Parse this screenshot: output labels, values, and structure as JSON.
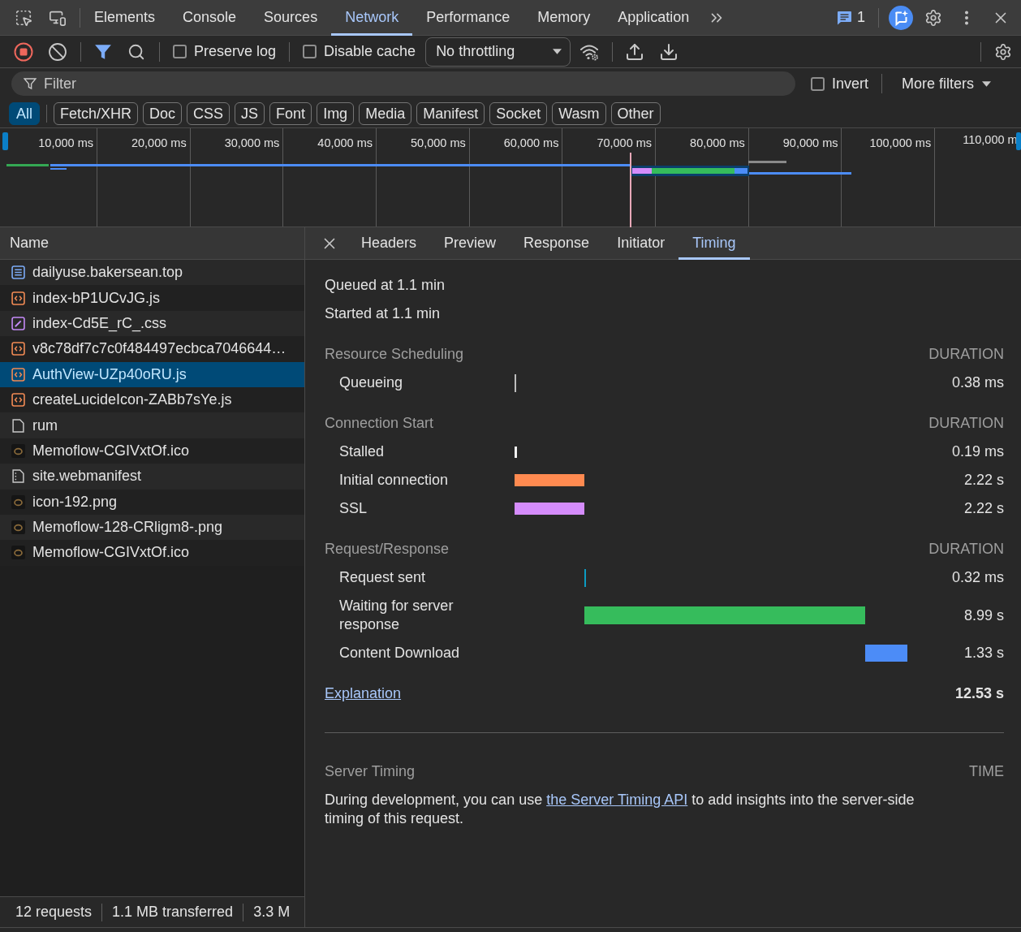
{
  "main_tabs": {
    "tabs": [
      {
        "label": "Elements",
        "selected": false
      },
      {
        "label": "Console",
        "selected": false
      },
      {
        "label": "Sources",
        "selected": false
      },
      {
        "label": "Network",
        "selected": true
      },
      {
        "label": "Performance",
        "selected": false
      },
      {
        "label": "Memory",
        "selected": false
      },
      {
        "label": "Application",
        "selected": false
      }
    ],
    "issues_count": "1"
  },
  "toolbar": {
    "recording": true,
    "filter_toggled": true,
    "preserve_log": {
      "label": "Preserve log",
      "checked": false
    },
    "disable_cache": {
      "label": "Disable cache",
      "checked": false
    },
    "throttling": "No throttling"
  },
  "filter_bar": {
    "placeholder": "Filter",
    "invert": {
      "label": "Invert",
      "checked": false
    },
    "more_filters": "More filters"
  },
  "type_filters": [
    {
      "label": "All",
      "selected": true
    },
    {
      "label": "Fetch/XHR",
      "selected": false
    },
    {
      "label": "Doc",
      "selected": false
    },
    {
      "label": "CSS",
      "selected": false
    },
    {
      "label": "JS",
      "selected": false
    },
    {
      "label": "Font",
      "selected": false
    },
    {
      "label": "Img",
      "selected": false
    },
    {
      "label": "Media",
      "selected": false
    },
    {
      "label": "Manifest",
      "selected": false
    },
    {
      "label": "Socket",
      "selected": false
    },
    {
      "label": "Wasm",
      "selected": false
    },
    {
      "label": "Other",
      "selected": false
    }
  ],
  "overview": {
    "ticks": [
      "10,000 ms",
      "20,000 ms",
      "30,000 ms",
      "40,000 ms",
      "50,000 ms",
      "60,000 ms",
      "70,000 ms",
      "80,000 ms",
      "90,000 ms",
      "100,000 ms",
      "110,000 m"
    ]
  },
  "request_list": {
    "column": "Name",
    "rows": [
      {
        "name": "dailyuse.bakersean.top",
        "kind": "document",
        "selected": false
      },
      {
        "name": "index-bP1UCvJG.js",
        "kind": "script",
        "selected": false
      },
      {
        "name": "index-Cd5E_rC_.css",
        "kind": "stylesheet",
        "selected": false
      },
      {
        "name": "v8c78df7c7c0f484497ecbca7046644…",
        "kind": "script",
        "selected": false
      },
      {
        "name": "AuthView-UZp40oRU.js",
        "kind": "script",
        "selected": true
      },
      {
        "name": "createLucideIcon-ZABb7sYe.js",
        "kind": "script",
        "selected": false
      },
      {
        "name": "rum",
        "kind": "fetch",
        "selected": false
      },
      {
        "name": "Memoflow-CGIVxtOf.ico",
        "kind": "image",
        "selected": false
      },
      {
        "name": "site.webmanifest",
        "kind": "manifest",
        "selected": false
      },
      {
        "name": "icon-192.png",
        "kind": "image",
        "selected": false
      },
      {
        "name": "Memoflow-128-CRligm8-.png",
        "kind": "image",
        "selected": false
      },
      {
        "name": "Memoflow-CGIVxtOf.ico",
        "kind": "image",
        "selected": false
      }
    ]
  },
  "detail": {
    "tabs": [
      {
        "label": "Headers",
        "selected": false
      },
      {
        "label": "Preview",
        "selected": false
      },
      {
        "label": "Response",
        "selected": false
      },
      {
        "label": "Initiator",
        "selected": false
      },
      {
        "label": "Timing",
        "selected": true
      }
    ],
    "queued": "Queued at 1.1 min",
    "started": "Started at 1.1 min",
    "sections": [
      {
        "title": "Resource Scheduling",
        "column": "DURATION",
        "rows": [
          {
            "label": "Queueing",
            "value": "0.38 ms",
            "color": "#bdbdbd"
          }
        ]
      },
      {
        "title": "Connection Start",
        "column": "DURATION",
        "rows": [
          {
            "label": "Stalled",
            "value": "0.19 ms",
            "color": "#f1f1f1"
          },
          {
            "label": "Initial connection",
            "value": "2.22 s",
            "color": "#ff8a50"
          },
          {
            "label": "SSL",
            "value": "2.22 s",
            "color": "#d58cfb"
          }
        ]
      },
      {
        "title": "Request/Response",
        "column": "DURATION",
        "rows": [
          {
            "label": "Request sent",
            "value": "0.32 ms",
            "color": "#0c9bc2"
          },
          {
            "label": "Waiting for server response",
            "value": "8.99 s",
            "color": "#36bc5c"
          },
          {
            "label": "Content Download",
            "value": "1.33 s",
            "color": "#4c8cf7"
          }
        ]
      }
    ],
    "explanation": "Explanation",
    "total": "12.53 s",
    "server_timing": {
      "title": "Server Timing",
      "column": "TIME",
      "text_before": "During development, you can use ",
      "link": "the Server Timing API",
      "text_after": " to add insights into the server-side timing of this request."
    }
  },
  "status_bar": [
    "12 requests",
    "1.1 MB transferred",
    "3.3 M"
  ]
}
